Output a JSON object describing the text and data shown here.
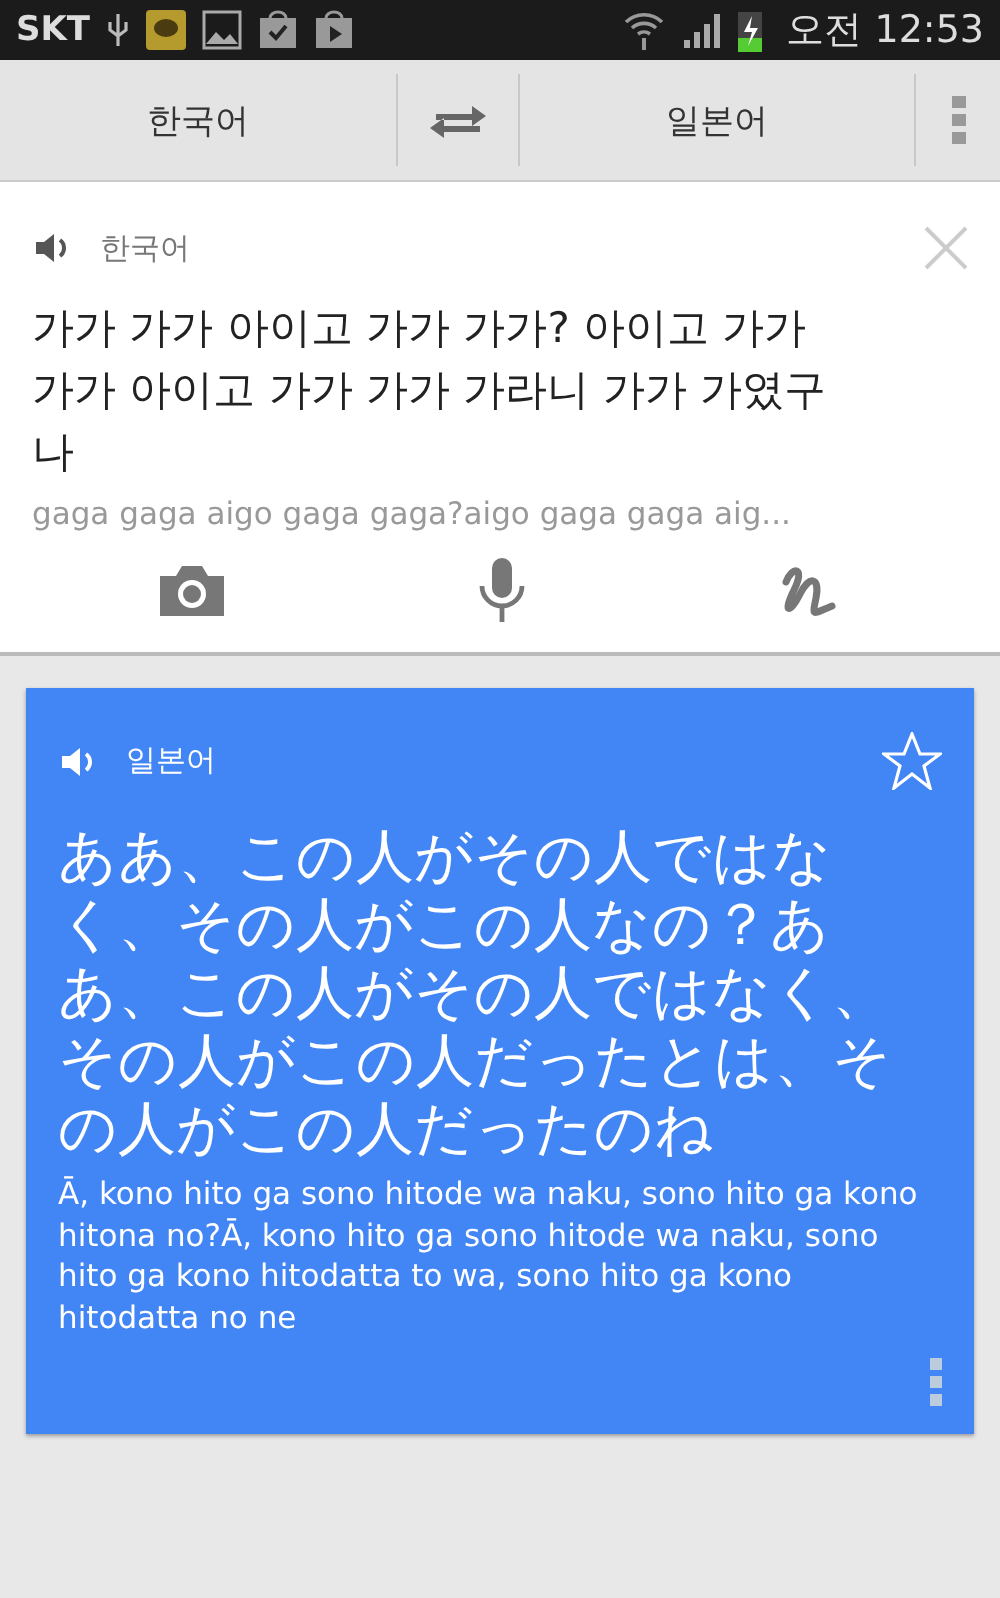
{
  "status_bar": {
    "carrier": "SKT",
    "time": "오전 12:53"
  },
  "toolbar": {
    "source_language": "한국어",
    "target_language": "일본어"
  },
  "source": {
    "language": "한국어",
    "text": "가가 가가 아이고 가가 가가? 아이고 가가 가가 아이고 가가 가가 가라니 가가 가였구나",
    "romanization": "gaga gaga aigo gaga gaga?aigo gaga gaga aig..."
  },
  "translation": {
    "language": "일본어",
    "starred": false,
    "text": "ああ、この人がその人ではなく、その人がこの人なの？ああ、この人がその人ではなく、その人がこの人だったとは、その人がこの人だったのね",
    "romanization": "Ā, kono hito ga sono hitode wa naku, sono hito ga kono hitona no?Ā, kono hito ga sono hitode wa naku, sono hito ga kono hitodatta to wa, sono hito ga kono hitodatta no ne"
  }
}
